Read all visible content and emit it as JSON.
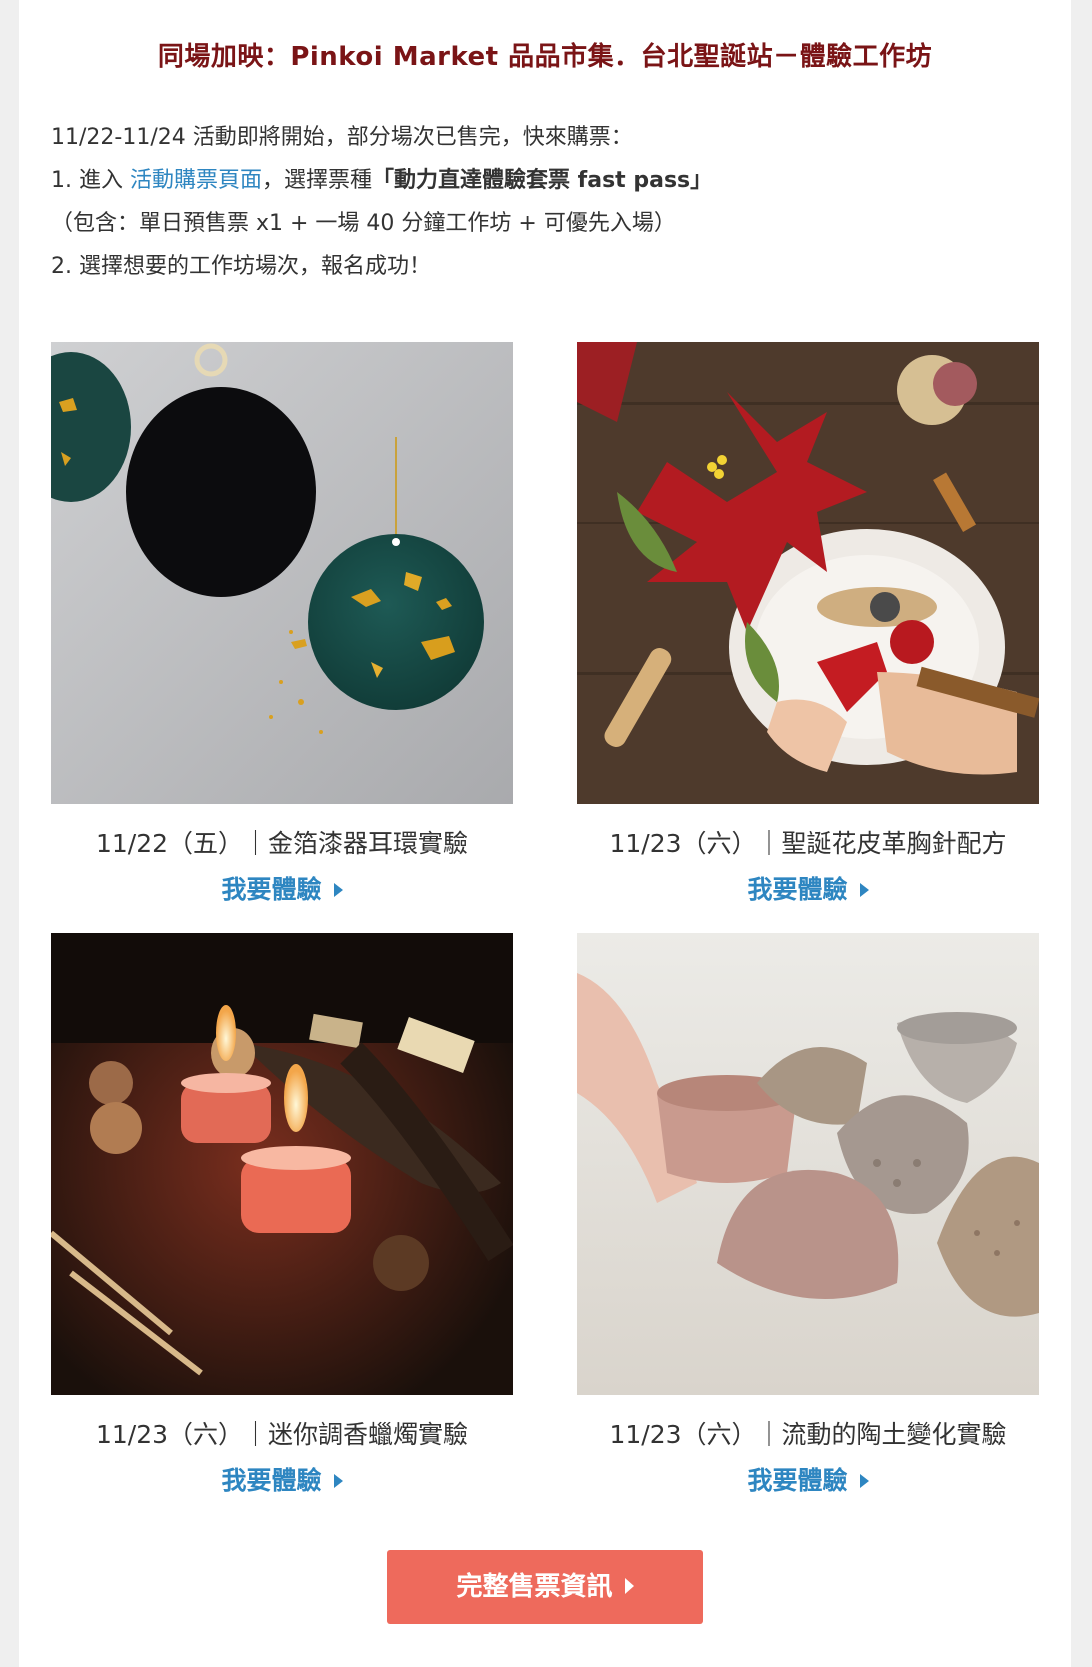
{
  "heading": "同場加映：Pinkoi Market 品品市集．台北聖誕站－體驗工作坊",
  "intro": {
    "line1": "11/22-11/24 活動即將開始，部分場次已售完，快來購票：",
    "line2_prefix": "1. 進入 ",
    "line2_link": "活動購票頁面",
    "line2_middle": "，選擇票種",
    "line2_bold": "「動力直達體驗套票 fast pass」",
    "line3": "（包含：單日預售票 x1 + 一場 40 分鐘工作坊 + 可優先入場）",
    "line4": "2. 選擇想要的工作坊場次，報名成功！"
  },
  "workshops": [
    {
      "title": "11/22（五）｜金箔漆器耳環實驗",
      "link": "我要體驗"
    },
    {
      "title": "11/23（六）｜聖誕花皮革胸針配方",
      "link": "我要體驗"
    },
    {
      "title": "11/23（六）｜迷你調香蠟燭實驗",
      "link": "我要體驗"
    },
    {
      "title": "11/23（六）｜流動的陶土變化實驗",
      "link": "我要體驗"
    }
  ],
  "cta": {
    "label": "完整售票資訊"
  },
  "colors": {
    "heading": "#7a1416",
    "link": "#2e86c1",
    "cta_bg": "#ee6a5c"
  }
}
